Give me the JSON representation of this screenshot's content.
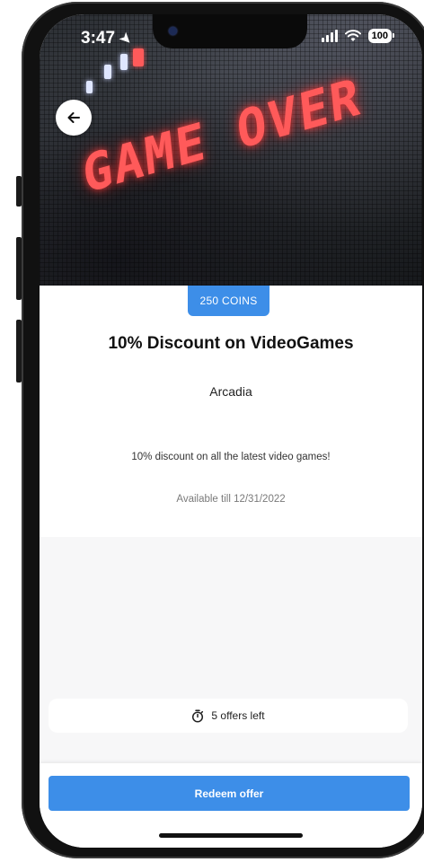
{
  "status_bar": {
    "time": "3:47",
    "battery": "100"
  },
  "hero": {
    "sign_text": "GAME OVER"
  },
  "offer": {
    "coins": "250 COINS",
    "title": "10% Discount on VideoGames",
    "merchant": "Arcadia",
    "description": "10% discount on all the latest video games!",
    "availability": "Available till 12/31/2022",
    "offers_left": "5 offers left"
  },
  "actions": {
    "redeem_label": "Redeem offer"
  },
  "colors": {
    "accent": "#3d8ee8",
    "sign_red": "#ff5a5a",
    "panel_grey": "#f7f7f8"
  },
  "icons": {
    "back": "arrow-left-icon",
    "timer": "stopwatch-icon",
    "location": "location-arrow-icon",
    "signal": "cellular-signal-icon",
    "wifi": "wifi-icon",
    "battery": "battery-icon"
  }
}
